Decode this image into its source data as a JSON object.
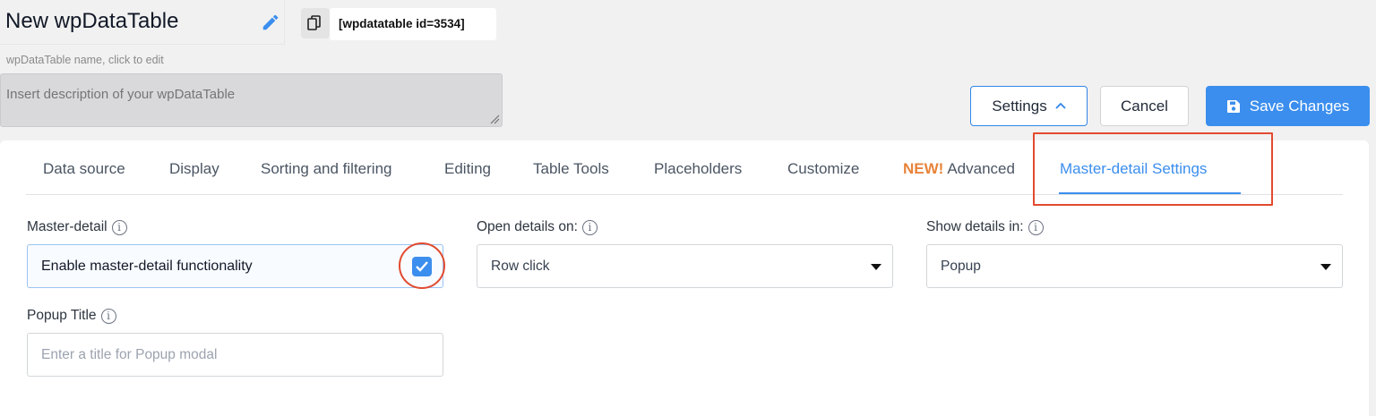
{
  "header": {
    "table_name": "New wpDataTable",
    "shortcode": "[wpdatatable id=3534]",
    "name_hint": "wpDataTable name, click to edit",
    "description_placeholder": "Insert description of your wpDataTable"
  },
  "actions": {
    "settings_label": "Settings",
    "cancel_label": "Cancel",
    "save_label": "Save Changes"
  },
  "tabs": [
    {
      "label": "Data source"
    },
    {
      "label": "Display"
    },
    {
      "label": "Sorting and filtering"
    },
    {
      "label": "Editing"
    },
    {
      "label": "Table Tools"
    },
    {
      "label": "Placeholders"
    },
    {
      "label": "Customize"
    },
    {
      "badge": "NEW!",
      "label": "Advanced"
    },
    {
      "label": "Master-detail Settings",
      "active": true
    }
  ],
  "form": {
    "master_detail": {
      "label": "Master-detail",
      "value": "Enable master-detail functionality",
      "checked": true
    },
    "open_details_on": {
      "label": "Open details on:",
      "value": "Row click"
    },
    "show_details_in": {
      "label": "Show details in:",
      "value": "Popup"
    },
    "popup_title": {
      "label": "Popup Title",
      "placeholder": "Enter a title for Popup modal"
    },
    "info_glyph": "i"
  },
  "colors": {
    "accent": "#3b8eee",
    "new_badge": "#e8833a",
    "annotation": "#e24a2f"
  }
}
